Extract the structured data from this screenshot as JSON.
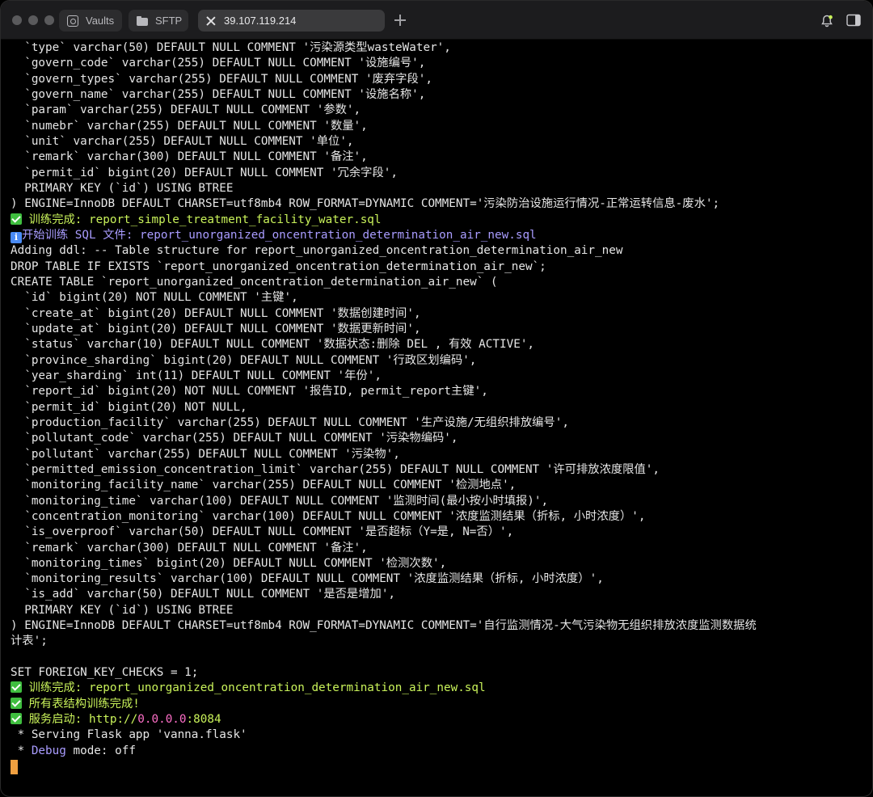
{
  "window": {
    "tabs": [
      {
        "label": "Vaults",
        "icon": "vault-icon"
      },
      {
        "label": "SFTP",
        "icon": "folder-icon"
      },
      {
        "label": "39.107.119.214",
        "icon": "close-icon",
        "active": true
      }
    ],
    "accent_color": "#c9f25a"
  },
  "terminal": {
    "lines": [
      "  `type` varchar(50) DEFAULT NULL COMMENT '污染源类型wasteWater',",
      "  `govern_code` varchar(255) DEFAULT NULL COMMENT '设施编号',",
      "  `govern_types` varchar(255) DEFAULT NULL COMMENT '废弃字段',",
      "  `govern_name` varchar(255) DEFAULT NULL COMMENT '设施名称',",
      "  `param` varchar(255) DEFAULT NULL COMMENT '参数',",
      "  `numebr` varchar(255) DEFAULT NULL COMMENT '数量',",
      "  `unit` varchar(255) DEFAULT NULL COMMENT '单位',",
      "  `remark` varchar(300) DEFAULT NULL COMMENT '备注',",
      "  `permit_id` bigint(20) DEFAULT NULL COMMENT '冗余字段',",
      "  PRIMARY KEY (`id`) USING BTREE",
      ") ENGINE=InnoDB DEFAULT CHARSET=utf8mb4 ROW_FORMAT=DYNAMIC COMMENT='污染防治设施运行情况-正常运转信息-废水';",
      " 训练完成: report_simple_treatment_facility_water.sql",
      "开始训练 SQL 文件: report_unorganized_oncentration_determination_air_new.sql",
      "Adding ddl: -- Table structure for report_unorganized_oncentration_determination_air_new",
      "DROP TABLE IF EXISTS `report_unorganized_oncentration_determination_air_new`;",
      "CREATE TABLE `report_unorganized_oncentration_determination_air_new` (",
      "  `id` bigint(20) NOT NULL COMMENT '主键',",
      "  `create_at` bigint(20) DEFAULT NULL COMMENT '数据创建时间',",
      "  `update_at` bigint(20) DEFAULT NULL COMMENT '数据更新时间',",
      "  `status` varchar(10) DEFAULT NULL COMMENT '数据状态:删除 DEL , 有效 ACTIVE',",
      "  `province_sharding` bigint(20) DEFAULT NULL COMMENT '行政区划编码',",
      "  `year_sharding` int(11) DEFAULT NULL COMMENT '年份',",
      "  `report_id` bigint(20) NOT NULL COMMENT '报告ID, permit_report主键',",
      "  `permit_id` bigint(20) NOT NULL,",
      "  `production_facility` varchar(255) DEFAULT NULL COMMENT '生产设施/无组织排放编号',",
      "  `pollutant_code` varchar(255) DEFAULT NULL COMMENT '污染物编码',",
      "  `pollutant` varchar(255) DEFAULT NULL COMMENT '污染物',",
      "  `permitted_emission_concentration_limit` varchar(255) DEFAULT NULL COMMENT '许可排放浓度限值',",
      "  `monitoring_facility_name` varchar(255) DEFAULT NULL COMMENT '检测地点',",
      "  `monitoring_time` varchar(100) DEFAULT NULL COMMENT '监测时间(最小按小时填报)',",
      "  `concentration_monitoring` varchar(100) DEFAULT NULL COMMENT '浓度监测结果（折标, 小时浓度）',",
      "  `is_overproof` varchar(50) DEFAULT NULL COMMENT '是否超标（Y=是, N=否）',",
      "  `remark` varchar(300) DEFAULT NULL COMMENT '备注',",
      "  `monitoring_times` bigint(20) DEFAULT NULL COMMENT '检测次数',",
      "  `monitoring_results` varchar(100) DEFAULT NULL COMMENT '浓度监测结果（折标, 小时浓度）',",
      "  `is_add` varchar(50) DEFAULT NULL COMMENT '是否是增加',",
      "  PRIMARY KEY (`id`) USING BTREE",
      ") ENGINE=InnoDB DEFAULT CHARSET=utf8mb4 ROW_FORMAT=DYNAMIC COMMENT='自行监测情况-大气污染物无组织排放浓度监测数据统",
      "计表';",
      "",
      "SET FOREIGN_KEY_CHECKS = 1;",
      " 训练完成: report_unorganized_oncentration_determination_air_new.sql",
      " 所有表结构训练完成!",
      " 服务启动: http://",
      " * Serving Flask app 'vanna.flask'",
      " * ",
      ""
    ],
    "server_host": "0.0.0.0",
    "server_port_suffix": ":8084",
    "debug_word": "Debug",
    "debug_rest": " mode: off",
    "colors": {
      "text": "#e6e6e6",
      "success": "#c9f25a",
      "info": "#a99cff",
      "host": "#ff6fc8",
      "cursor": "#f0a040"
    }
  }
}
